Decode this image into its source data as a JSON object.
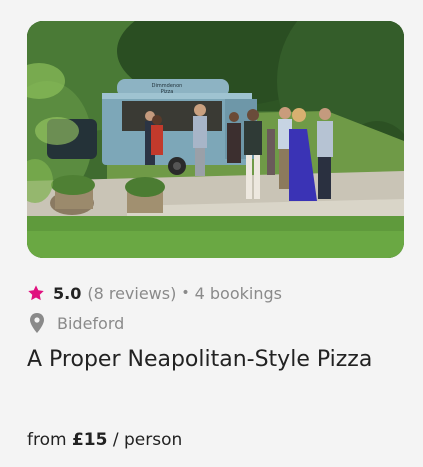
{
  "image": {
    "alt": "Guests gathered around a blue horsebox pizza van on a lawn"
  },
  "van": {
    "sign_line1": "Dimmdenon",
    "sign_line2": "Pizza"
  },
  "rating": {
    "score": "5.0",
    "reviews": "(8 reviews)",
    "separator": "•",
    "bookings": "4 bookings"
  },
  "location": {
    "name": "Bideford"
  },
  "title": "A Proper Neapolitan-Style Pizza",
  "price": {
    "from": "from",
    "amount": "£15",
    "unit": "/ person"
  },
  "colors": {
    "star": "#e0117f",
    "muted": "#8a8a8a",
    "text": "#222222",
    "background": "#f4f4f4"
  },
  "icons": {
    "rating": "star-icon",
    "location": "map-pin-icon"
  }
}
